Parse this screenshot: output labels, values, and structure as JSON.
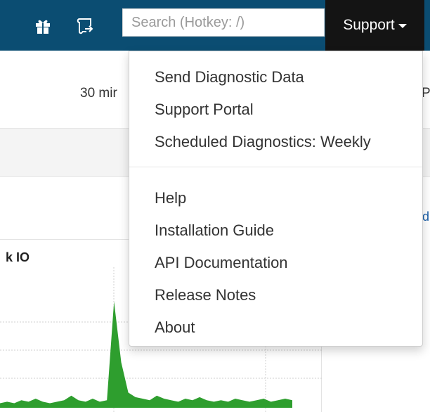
{
  "topbar": {
    "gift_icon": "gift-icon",
    "release_icon": "scroll-arrow-icon",
    "search": {
      "placeholder": "Search (Hotkey: /)",
      "value": ""
    },
    "support_label": "Support",
    "colors": {
      "bar": "#0b4d72",
      "support_bg": "#141414"
    }
  },
  "background": {
    "timerange_label": "30 mir",
    "right_clip_text": "P",
    "right_clip_link": "d",
    "chart": {
      "title": "k IO",
      "color": "#2e9e2e"
    }
  },
  "chart_data": {
    "type": "area",
    "title": "k IO",
    "series": [
      {
        "values": [
          3,
          4,
          3,
          5,
          4,
          6,
          4,
          3,
          4,
          5,
          8,
          5,
          4,
          6,
          4,
          5,
          70,
          30,
          10,
          7,
          6,
          5,
          8,
          6,
          5,
          4,
          6,
          5,
          7,
          5,
          4,
          5,
          4,
          6,
          5,
          4,
          5,
          6,
          4,
          5,
          6,
          5
        ]
      }
    ],
    "grid": true
  },
  "support_menu": {
    "items_top": [
      "Send Diagnostic Data",
      "Support Portal",
      "Scheduled Diagnostics: Weekly"
    ],
    "items_bottom": [
      "Help",
      "Installation Guide",
      "API Documentation",
      "Release Notes",
      "About"
    ]
  }
}
